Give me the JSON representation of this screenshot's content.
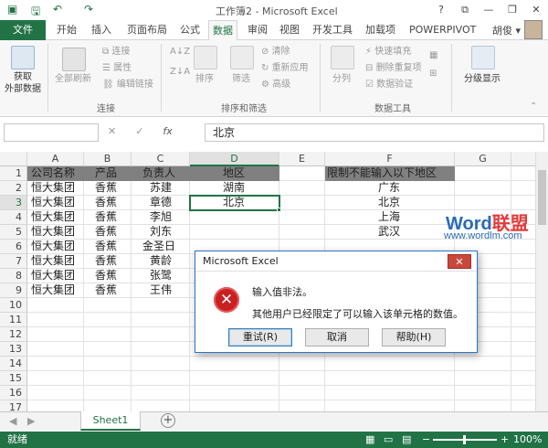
{
  "window": {
    "title": "工作簿2 - Microsoft Excel",
    "min": "—",
    "restore": "❐",
    "close": "✕",
    "help": "?",
    "ribbon_opts": "⧉"
  },
  "ribbon_tabs": [
    "文件",
    "开始",
    "插入",
    "页面布局",
    "公式",
    "数据",
    "审阅",
    "视图",
    "开发工具",
    "加载项",
    "POWERPIVOT"
  ],
  "active_tab": "数据",
  "user": "胡俊 ▾",
  "ribbon": {
    "get_external": "获取\n外部数据",
    "refresh_all": "全部刷新",
    "connections": "连接",
    "properties": "属性",
    "edit_links": "编辑链接",
    "group_connections": "连接",
    "sort": "排序",
    "filter": "筛选",
    "clear": "清除",
    "reapply": "重新应用",
    "advanced": "高级",
    "group_sort": "排序和筛选",
    "split": "分列",
    "flash_fill": "快速填充",
    "remove_dup": "删除重复项",
    "validation": "数据验证",
    "group_tools": "数据工具",
    "outline": "分级显示"
  },
  "formula_bar": {
    "name_box": "",
    "cancel": "✕",
    "enter": "✓",
    "fx": "fx",
    "content": "北京"
  },
  "columns": [
    "A",
    "B",
    "C",
    "D",
    "E",
    "F",
    "G"
  ],
  "rows": [
    "1",
    "2",
    "3",
    "4",
    "5",
    "6",
    "7",
    "8",
    "9",
    "10",
    "11",
    "12",
    "13",
    "14",
    "15",
    "16",
    "17"
  ],
  "cells": {
    "header": [
      "公司名称",
      "产品",
      "负责人",
      "地区"
    ],
    "data": [
      [
        "恒大集团",
        "香蕉",
        "苏建",
        "湖南"
      ],
      [
        "恒大集团",
        "香蕉",
        "章德",
        "北京"
      ],
      [
        "恒大集团",
        "香蕉",
        "李旭",
        ""
      ],
      [
        "恒大集团",
        "香蕉",
        "刘东",
        ""
      ],
      [
        "恒大集团",
        "香蕉",
        "金圣日",
        ""
      ],
      [
        "恒大集团",
        "香蕉",
        "黄龄",
        ""
      ],
      [
        "恒大集团",
        "香蕉",
        "张鹭",
        ""
      ],
      [
        "恒大集团",
        "香蕉",
        "王伟",
        ""
      ]
    ],
    "restrict_header": "限制不能输入以下地区",
    "restrict_values": [
      "广东",
      "北京",
      "上海",
      "武汉"
    ]
  },
  "sheet_tabs": [
    "Sheet1"
  ],
  "add_sheet": "+",
  "status": {
    "ready": "就绪",
    "zoom": "100%"
  },
  "dialog": {
    "title": "Microsoft Excel",
    "close": "✕",
    "icon": "error-icon",
    "message1": "输入值非法。",
    "message2": "其他用户已经限定了可以输入该单元格的数值。",
    "retry": "重试(R)",
    "cancel": "取消",
    "help": "帮助(H)"
  },
  "watermark": {
    "word": "Word",
    "lianmeng": "联盟",
    "url": "www.wordlm.com"
  },
  "colors": {
    "excel_green": "#217346",
    "header_fill": "#808080",
    "error_red": "#c92121"
  }
}
